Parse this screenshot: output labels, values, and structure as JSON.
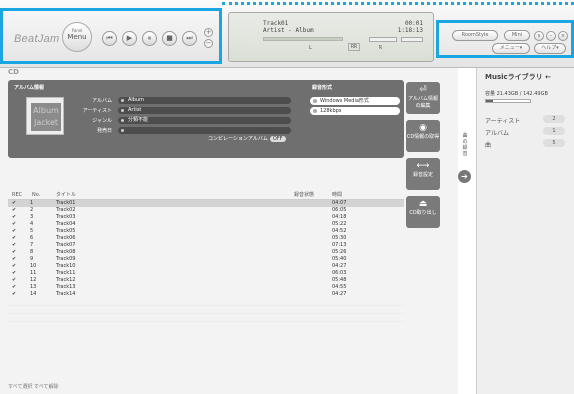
{
  "app": {
    "logo": "BeatJam"
  },
  "menu_button": {
    "small": "Panel",
    "label": "Menu"
  },
  "transport": [
    {
      "name": "prev-button",
      "glyph": "⏮"
    },
    {
      "name": "play-button",
      "glyph": "▶"
    },
    {
      "name": "pause-button",
      "glyph": "⏸"
    },
    {
      "name": "stop-button",
      "glyph": "■"
    },
    {
      "name": "next-button",
      "glyph": "⏭"
    }
  ],
  "volume": {
    "up": "+",
    "down": "−"
  },
  "display": {
    "track": "Track01",
    "artist": "Artist - Album",
    "time1": "00:01",
    "time2": "1:18:13",
    "label1": "L",
    "label2": "R",
    "label3": "RR"
  },
  "top_right": {
    "room_style": "RoomStyle",
    "mini": "Mini",
    "menu": "メニュー",
    "help": "ヘルプ"
  },
  "main": {
    "title": "CD"
  },
  "album_panel": {
    "header": "アルバム情報",
    "fields": [
      {
        "label": "アルバム",
        "value": "Album"
      },
      {
        "label": "アーティスト",
        "value": "Artist"
      },
      {
        "label": "ジャンル",
        "value": "分類不能"
      },
      {
        "label": "発売日",
        "value": ""
      }
    ],
    "jacket_text": "Album Jacket",
    "compilation": "コンピレーションアルバム",
    "compilation_tag": "OFF",
    "format_header": "録音形式",
    "formats": [
      "Windows Media形式",
      "128kbps"
    ]
  },
  "side_buttons": [
    {
      "label": "アルバム情報の編集",
      "icon": "⏎"
    },
    {
      "label": "CD情報の取得",
      "icon": "◉"
    },
    {
      "label": "録音設定",
      "icon": "⟷"
    },
    {
      "label": "CD取り出し",
      "icon": "⏏"
    }
  ],
  "table": {
    "headers": {
      "rec": "REC",
      "no": "No.",
      "title": "タイトル",
      "status": "録音状態",
      "time": "時間"
    },
    "rows": [
      {
        "no": 1,
        "title": "Track01",
        "time": "04:07"
      },
      {
        "no": 2,
        "title": "Track02",
        "time": "06:05"
      },
      {
        "no": 3,
        "title": "Track03",
        "time": "04:18"
      },
      {
        "no": 4,
        "title": "Track04",
        "time": "05:22"
      },
      {
        "no": 5,
        "title": "Track05",
        "time": "04:52"
      },
      {
        "no": 6,
        "title": "Track06",
        "time": "05:30"
      },
      {
        "no": 7,
        "title": "Track07",
        "time": "07:13"
      },
      {
        "no": 8,
        "title": "Track08",
        "time": "05:26"
      },
      {
        "no": 9,
        "title": "Track09",
        "time": "05:40"
      },
      {
        "no": 10,
        "title": "Track10",
        "time": "04:27"
      },
      {
        "no": 11,
        "title": "Track11",
        "time": "06:03"
      },
      {
        "no": 12,
        "title": "Track12",
        "time": "05:48"
      },
      {
        "no": 13,
        "title": "Track13",
        "time": "04:55"
      },
      {
        "no": 14,
        "title": "Track14",
        "time": "04:27"
      }
    ]
  },
  "footer": {
    "select_all": "すべて選択",
    "deselect_all": "すべて解除"
  },
  "vertical_label": "曲の録音",
  "library": {
    "title": "Musicライブラリ",
    "capacity": "容量 21.43GB / 142.49GB",
    "capacity_fraction": 0.15,
    "stats": [
      {
        "label": "アーティスト",
        "value": "2"
      },
      {
        "label": "アルバム",
        "value": "1"
      },
      {
        "label": "曲",
        "value": "5"
      }
    ]
  }
}
